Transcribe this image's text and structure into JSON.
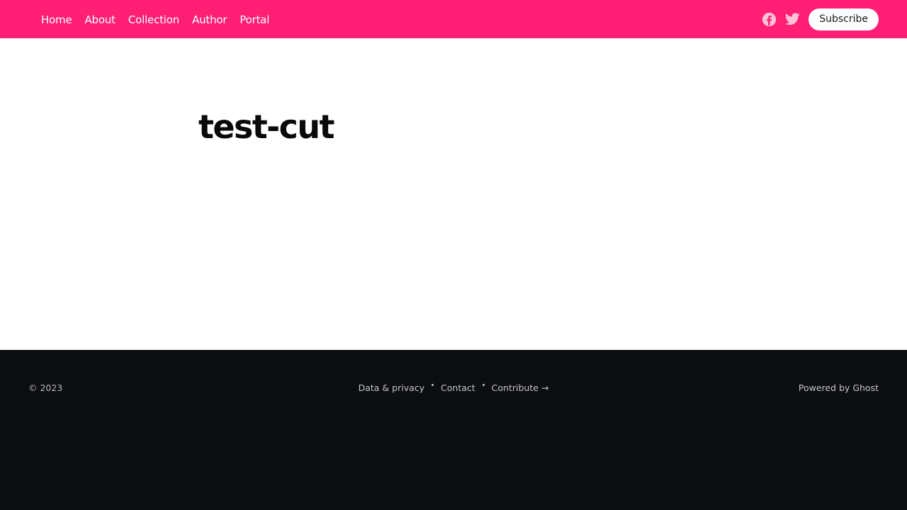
{
  "header": {
    "nav": [
      {
        "label": "Home"
      },
      {
        "label": "About"
      },
      {
        "label": "Collection"
      },
      {
        "label": "Author"
      },
      {
        "label": "Portal"
      }
    ],
    "social": [
      {
        "icon": "facebook-icon"
      },
      {
        "icon": "twitter-icon"
      }
    ],
    "subscribe_label": "Subscribe",
    "accent_color": "#ff1f74"
  },
  "main": {
    "title": "test-cut"
  },
  "footer": {
    "copyright": "© 2023",
    "links": [
      {
        "label": "Data & privacy"
      },
      {
        "label": "Contact"
      },
      {
        "label": "Contribute →"
      }
    ],
    "powered_by": "Powered by Ghost",
    "background_color": "#0c0d0f"
  }
}
